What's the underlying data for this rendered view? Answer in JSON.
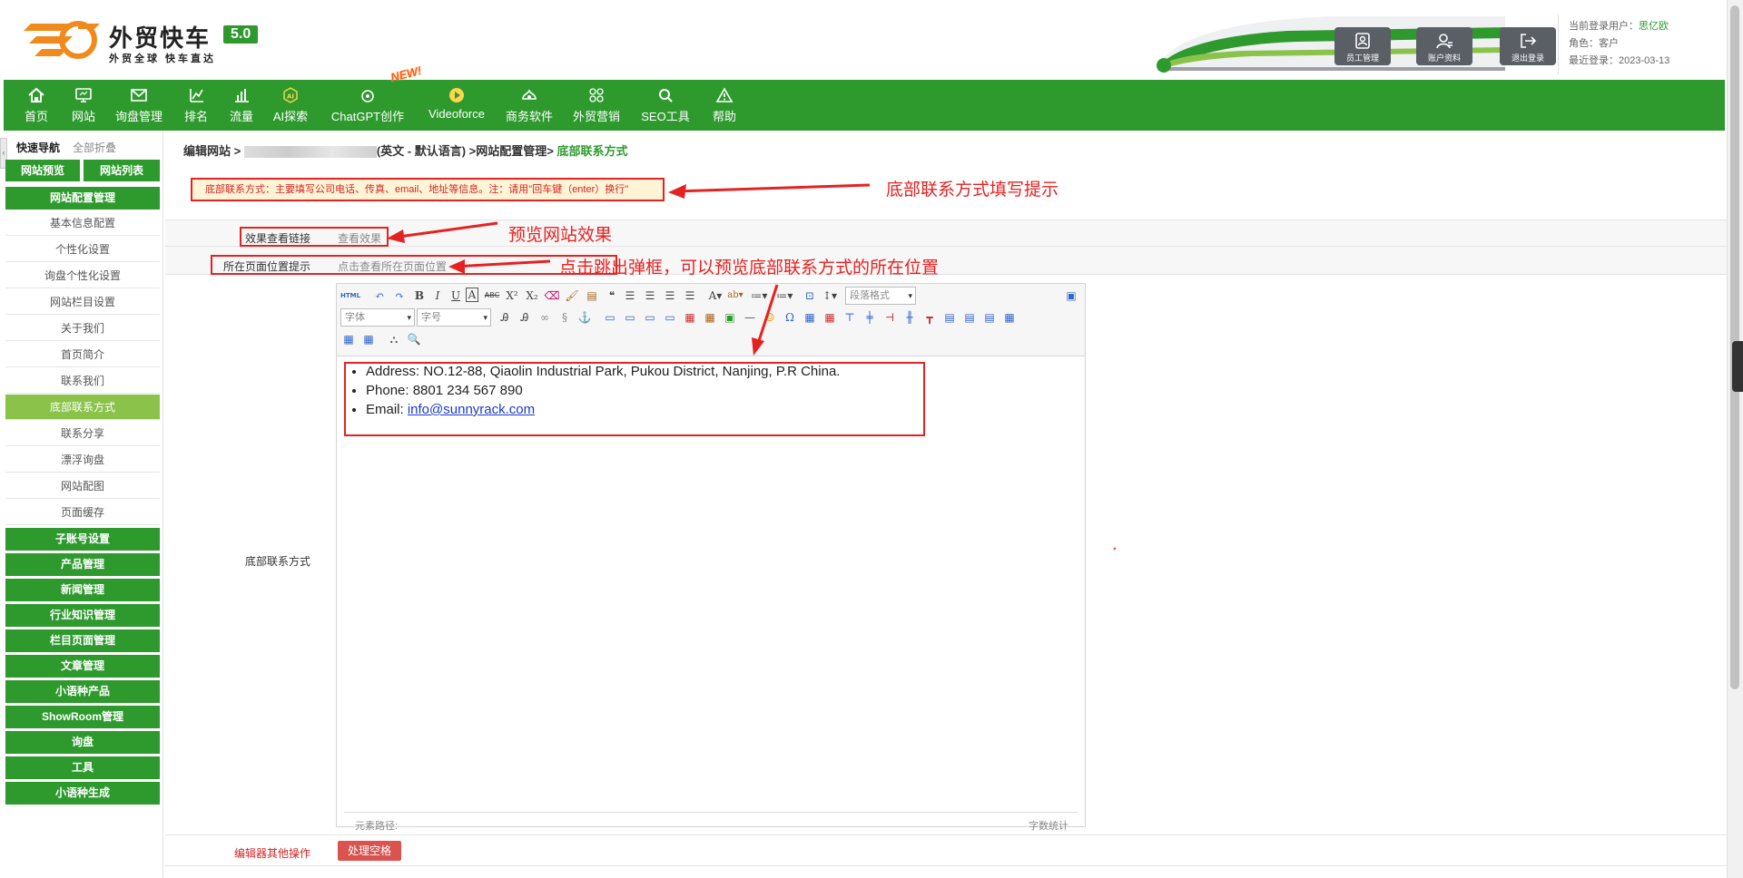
{
  "header": {
    "logo_title": "外贸快车",
    "logo_version": "5.0",
    "logo_sub": "外贸全球 快车直达",
    "buttons": [
      {
        "label": "员工管理",
        "icon": "staff-icon"
      },
      {
        "label": "账户资料",
        "icon": "account-icon"
      },
      {
        "label": "退出登录",
        "icon": "logout-icon"
      }
    ],
    "user": {
      "current_label": "当前登录用户：",
      "current_name": "思亿欧",
      "role_label": "角色：",
      "role": "客户",
      "last_login_label": "最近登录：",
      "last_login": "2023-03-13"
    }
  },
  "nav": {
    "items": [
      {
        "label": "首页",
        "icon": "home-icon"
      },
      {
        "label": "网站",
        "icon": "monitor-icon"
      },
      {
        "label": "询盘管理",
        "icon": "mail-icon"
      },
      {
        "label": "排名",
        "icon": "rank-icon"
      },
      {
        "label": "流量",
        "icon": "bar-chart-icon"
      },
      {
        "label": "AI探索",
        "icon": "ai-icon"
      },
      {
        "label": "ChatGPT创作",
        "icon": "chatgpt-icon"
      },
      {
        "label": "Videoforce",
        "icon": "play-icon"
      },
      {
        "label": "商务软件",
        "icon": "software-icon"
      },
      {
        "label": "外贸营销",
        "icon": "marketing-icon"
      },
      {
        "label": "SEO工具",
        "icon": "search-icon"
      },
      {
        "label": "帮助",
        "icon": "warning-icon"
      }
    ],
    "new_badge": "NEW!"
  },
  "sidebar": {
    "quick_nav": "快速导航",
    "collapse_all": "全部折叠",
    "preview_button": "网站预览",
    "list_button": "网站列表",
    "config_group": "网站配置管理",
    "sub_items": [
      "基本信息配置",
      "个性化设置",
      "询盘个性化设置",
      "网站栏目设置",
      "关于我们",
      "首页简介",
      "联系我们",
      "底部联系方式",
      "联系分享",
      "漂浮询盘",
      "网站配图",
      "页面缓存"
    ],
    "active_index": 7,
    "groups": [
      "子账号设置",
      "产品管理",
      "新闻管理",
      "行业知识管理",
      "栏目页面管理",
      "文章管理",
      "小语种产品",
      "ShowRoom管理",
      "询盘",
      "工具",
      "小语种生成"
    ]
  },
  "main": {
    "crumb_prefix": "编辑网站 >",
    "crumb_lang": "(英文 - 默认语言) >网站配置管理>",
    "crumb_current": "底部联系方式",
    "tip": "底部联系方式：主要填写公司电话、传真、email、地址等信息。注：请用\"回车键（enter）换行\"",
    "rows": {
      "preview_label": "效果查看链接",
      "preview_link": "查看效果",
      "position_label": "所在页面位置提示",
      "position_link": "点击查看所在页面位置",
      "footer_label": "底部联系方式",
      "other_label": "编辑器其他操作",
      "process_button": "处理空格"
    },
    "editor": {
      "font_placeholder": "字体",
      "size_placeholder": "字号",
      "paragraph_placeholder": "段落格式",
      "lines": [
        "Address: NO.12-88, Qiaolin Industrial Park, Pukou District, Nanjing, P.R China.",
        "Phone: 8801 234 567 890"
      ],
      "email_prefix": "Email: ",
      "email": "info@sunnyrack.com",
      "path_label": "元素路径:",
      "word_count": "字数统计"
    },
    "required_mark": "*"
  },
  "annotations": {
    "tip_note": "底部联系方式填写提示",
    "preview_note": "预览网站效果",
    "popup_note": "点击跳出弹框，可以预览底部联系方式的所在位置"
  },
  "colors": {
    "brand_green": "#2e9a2e",
    "active_green": "#8bc34a",
    "annotation_red": "#e52222",
    "logo_orange": "#f08a1c"
  }
}
